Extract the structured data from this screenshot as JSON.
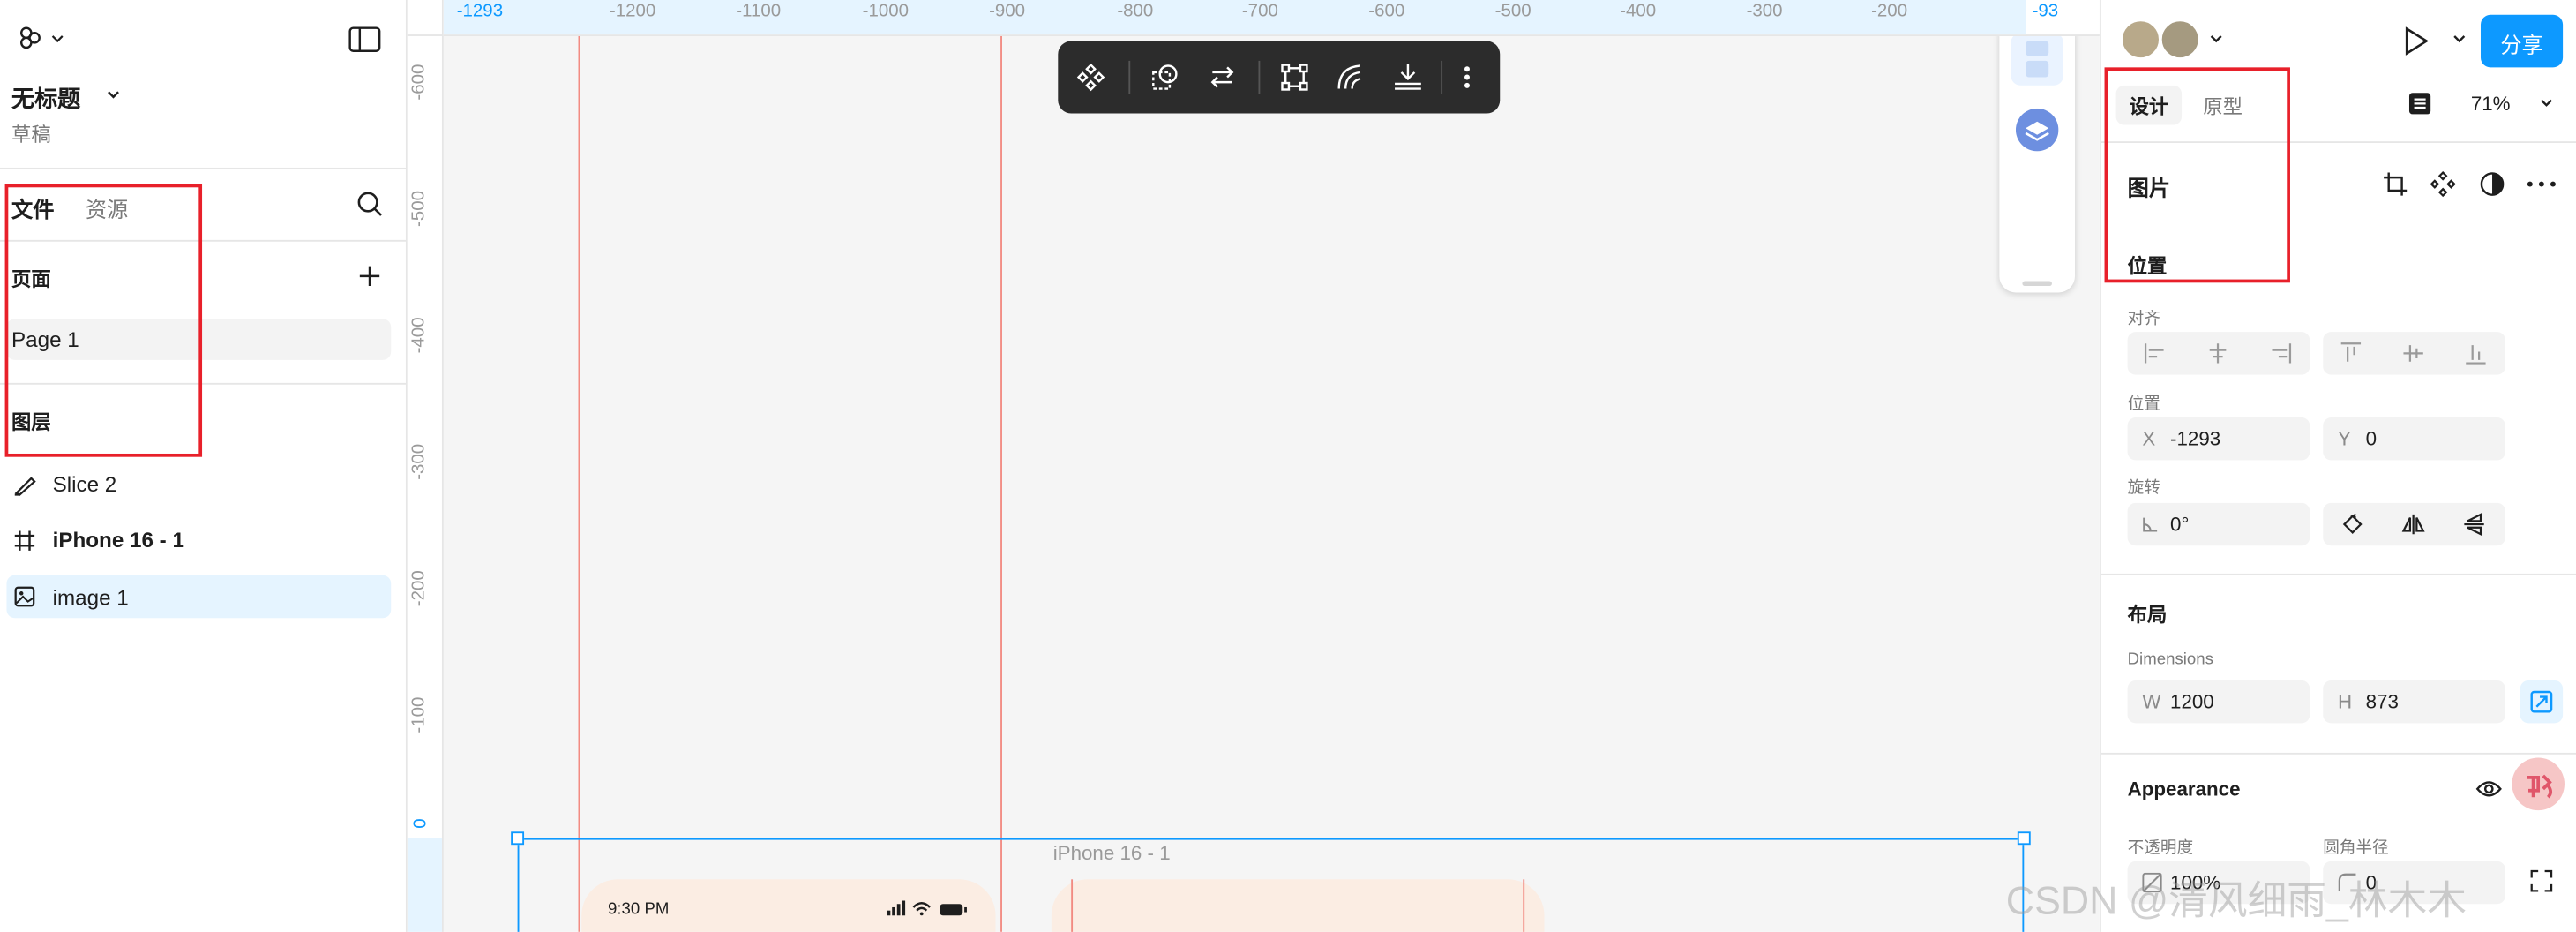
{
  "left_panel": {
    "file_title": "无标题",
    "file_subtitle": "草稿",
    "tabs": {
      "file": "文件",
      "assets": "资源"
    },
    "pages_heading": "页面",
    "pages": [
      {
        "label": "Page 1"
      }
    ],
    "layers_heading": "图层",
    "layers": [
      {
        "label": "Slice 2",
        "icon": "slice-icon",
        "bold": false,
        "selected": false
      },
      {
        "label": "iPhone 16 - 1",
        "icon": "frame-icon",
        "bold": true,
        "selected": false
      },
      {
        "label": "image 1",
        "icon": "image-icon",
        "bold": false,
        "selected": true
      }
    ]
  },
  "canvas": {
    "ruler_top": {
      "selection_start": "-1293",
      "selection_end": "-93",
      "ticks": [
        "-1200",
        "-1100",
        "-1000",
        "-900",
        "-800",
        "-700",
        "-600",
        "-500",
        "-400",
        "-300",
        "-200"
      ]
    },
    "ruler_left": {
      "ticks": [
        "-600",
        "-500",
        "-400",
        "-300",
        "-200",
        "-100"
      ],
      "zero": "0"
    },
    "frame_label": "iPhone 16 - 1",
    "phone_time": "9:30 PM",
    "toolbar_icons": [
      "component-icon",
      "mask-icon",
      "swap-icon",
      "transform-icon",
      "path-icon",
      "export-icon",
      "more-icon"
    ],
    "watermark": "CSDN @清风细雨_林木木"
  },
  "right_panel": {
    "share_label": "分享",
    "tabs": {
      "design": "设计",
      "prototype": "原型"
    },
    "zoom": "71%",
    "section_title": "图片",
    "position_heading": "位置",
    "align_label": "对齐",
    "position_label": "位置",
    "x_label": "X",
    "x_value": "-1293",
    "y_label": "Y",
    "y_value": "0",
    "rotation_label": "旋转",
    "rotation_value": "0°",
    "layout_heading": "布局",
    "dimensions_label": "Dimensions",
    "w_label": "W",
    "w_value": "1200",
    "h_label": "H",
    "h_value": "873",
    "appearance_heading": "Appearance",
    "opacity_label": "不透明度",
    "opacity_value": "100%",
    "radius_label": "圆角半径",
    "radius_value": "0"
  },
  "colors": {
    "accent": "#0d99ff",
    "highlight_box": "#e8202a",
    "guide_line": "#f28b82",
    "selection": "#0d99ff",
    "toolbar_bg": "#2c2c2c"
  }
}
